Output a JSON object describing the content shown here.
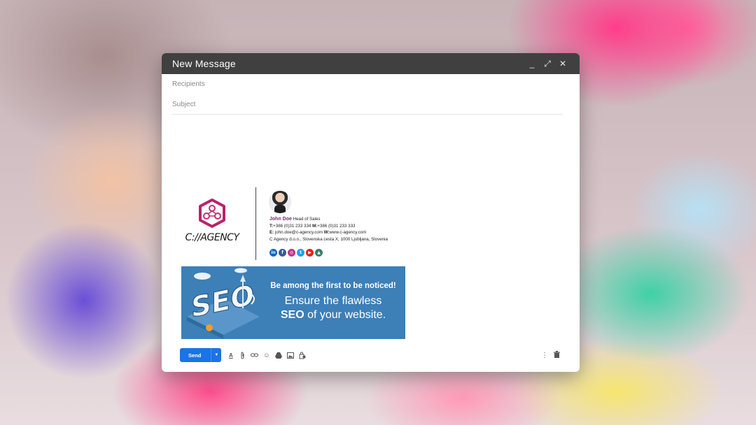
{
  "window": {
    "title": "New Message",
    "controls": {
      "minimize": "_",
      "expand": "⤢",
      "close": "✕"
    }
  },
  "fields": {
    "recipients_placeholder": "Recipients",
    "subject_placeholder": "Subject"
  },
  "signature": {
    "logo_text": "C://AGENCY",
    "name": "John Doe",
    "title": "Head of Sales",
    "phone_label": "T:",
    "phone": "+386 (0)31 233 334",
    "mobile_label": "M:",
    "mobile": "+386 (0)31 233 333",
    "email_label": "E:",
    "email": "john.doe@c-agency.com",
    "web_label": "W:",
    "web": "www.c-agency.com",
    "address": "C Agency d.o.o., Slovenska cesta X, 1000 Ljubljana, Slovenia",
    "social": [
      {
        "icon": "linkedin-icon",
        "glyph": "in",
        "color": "#0a66c2"
      },
      {
        "icon": "facebook-icon",
        "glyph": "f",
        "color": "#3b5998"
      },
      {
        "icon": "instagram-icon",
        "glyph": "◎",
        "color": "#c13584"
      },
      {
        "icon": "twitter-icon",
        "glyph": "t",
        "color": "#1da1f2"
      },
      {
        "icon": "youtube-icon",
        "glyph": "▶",
        "color": "#e62117"
      },
      {
        "icon": "google-drive-icon",
        "glyph": "▲",
        "color": "#3a7f6a"
      }
    ]
  },
  "banner": {
    "art_text": "SEO",
    "line1": "Be among the first to be noticed!",
    "line2": "Ensure the flawless",
    "line3_bold": "SEO",
    "line3_rest": " of your website."
  },
  "toolbar": {
    "send_label": "Send",
    "icons": [
      "format-text-icon",
      "attach-icon",
      "link-icon",
      "emoji-icon",
      "drive-icon",
      "image-icon",
      "confidential-icon"
    ],
    "right_icons": [
      "more-options-icon",
      "delete-icon"
    ]
  },
  "colors": {
    "titlebar": "#404040",
    "send_button": "#1a73e8",
    "banner": "#3d7fb7",
    "logo_accent": "#b8236a",
    "name_accent": "#7b2a6a"
  }
}
